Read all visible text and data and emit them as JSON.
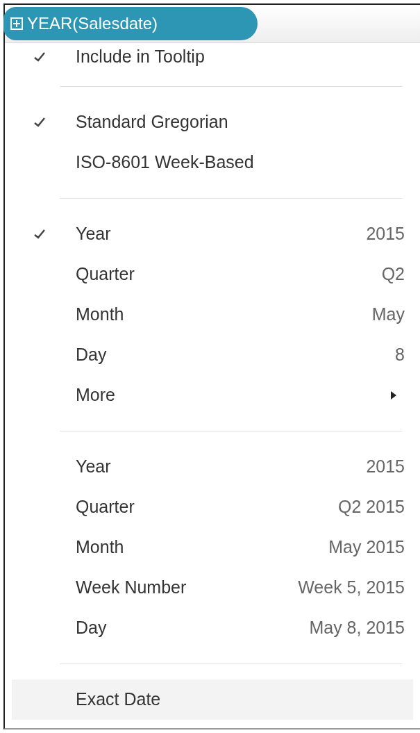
{
  "pill": {
    "label": "YEAR(Salesdate)"
  },
  "sections": [
    {
      "items": [
        {
          "kind": "item",
          "label": "Include in Tooltip",
          "checked": true,
          "highlighted": false
        }
      ]
    },
    {
      "items": [
        {
          "kind": "item",
          "label": "Standard Gregorian",
          "checked": true,
          "highlighted": false
        },
        {
          "kind": "item",
          "label": "ISO-8601 Week-Based",
          "checked": false,
          "highlighted": false
        }
      ]
    },
    {
      "items": [
        {
          "kind": "item",
          "label": "Year",
          "value": "2015",
          "checked": true,
          "highlighted": false
        },
        {
          "kind": "item",
          "label": "Quarter",
          "value": "Q2",
          "checked": false,
          "highlighted": false
        },
        {
          "kind": "item",
          "label": "Month",
          "value": "May",
          "checked": false,
          "highlighted": false
        },
        {
          "kind": "item",
          "label": "Day",
          "value": "8",
          "checked": false,
          "highlighted": false
        },
        {
          "kind": "submenu",
          "label": "More",
          "checked": false,
          "highlighted": false
        }
      ]
    },
    {
      "items": [
        {
          "kind": "item",
          "label": "Year",
          "value": "2015",
          "checked": false,
          "highlighted": false
        },
        {
          "kind": "item",
          "label": "Quarter",
          "value": "Q2 2015",
          "checked": false,
          "highlighted": false
        },
        {
          "kind": "item",
          "label": "Month",
          "value": "May 2015",
          "checked": false,
          "highlighted": false
        },
        {
          "kind": "item",
          "label": "Week Number",
          "value": "Week 5, 2015",
          "checked": false,
          "highlighted": false
        },
        {
          "kind": "item",
          "label": "Day",
          "value": "May 8, 2015",
          "checked": false,
          "highlighted": false
        }
      ]
    },
    {
      "items": [
        {
          "kind": "item",
          "label": "Exact Date",
          "checked": false,
          "highlighted": true
        }
      ]
    }
  ]
}
